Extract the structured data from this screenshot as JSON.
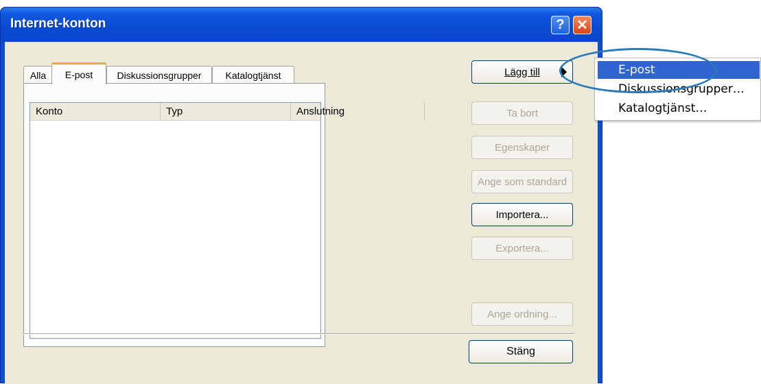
{
  "window": {
    "title": "Internet-konton",
    "help_label": "?",
    "close_label": "✕"
  },
  "tabs": [
    {
      "label": "Alla"
    },
    {
      "label": "E-post",
      "active": true
    },
    {
      "label": "Diskussionsgrupper"
    },
    {
      "label": "Katalogtjänst"
    }
  ],
  "table": {
    "columns": [
      "Konto",
      "Typ",
      "Anslutning"
    ],
    "rows": []
  },
  "buttons": {
    "add": "Lägg till",
    "remove": "Ta bort",
    "properties": "Egenskaper",
    "set_default": "Ange som standard",
    "import": "Importera...",
    "export": "Exportera...",
    "set_order": "Ange ordning...",
    "close": "Stäng"
  },
  "add_menu": {
    "items": [
      "E-post",
      "Diskussionsgrupper…",
      "Katalogtjänst…"
    ],
    "selected": "E-post"
  },
  "colors": {
    "titlebar": "#0a4bd2",
    "menu_selected": "#3064d0",
    "annotation_ellipse": "#2a7ab8"
  }
}
